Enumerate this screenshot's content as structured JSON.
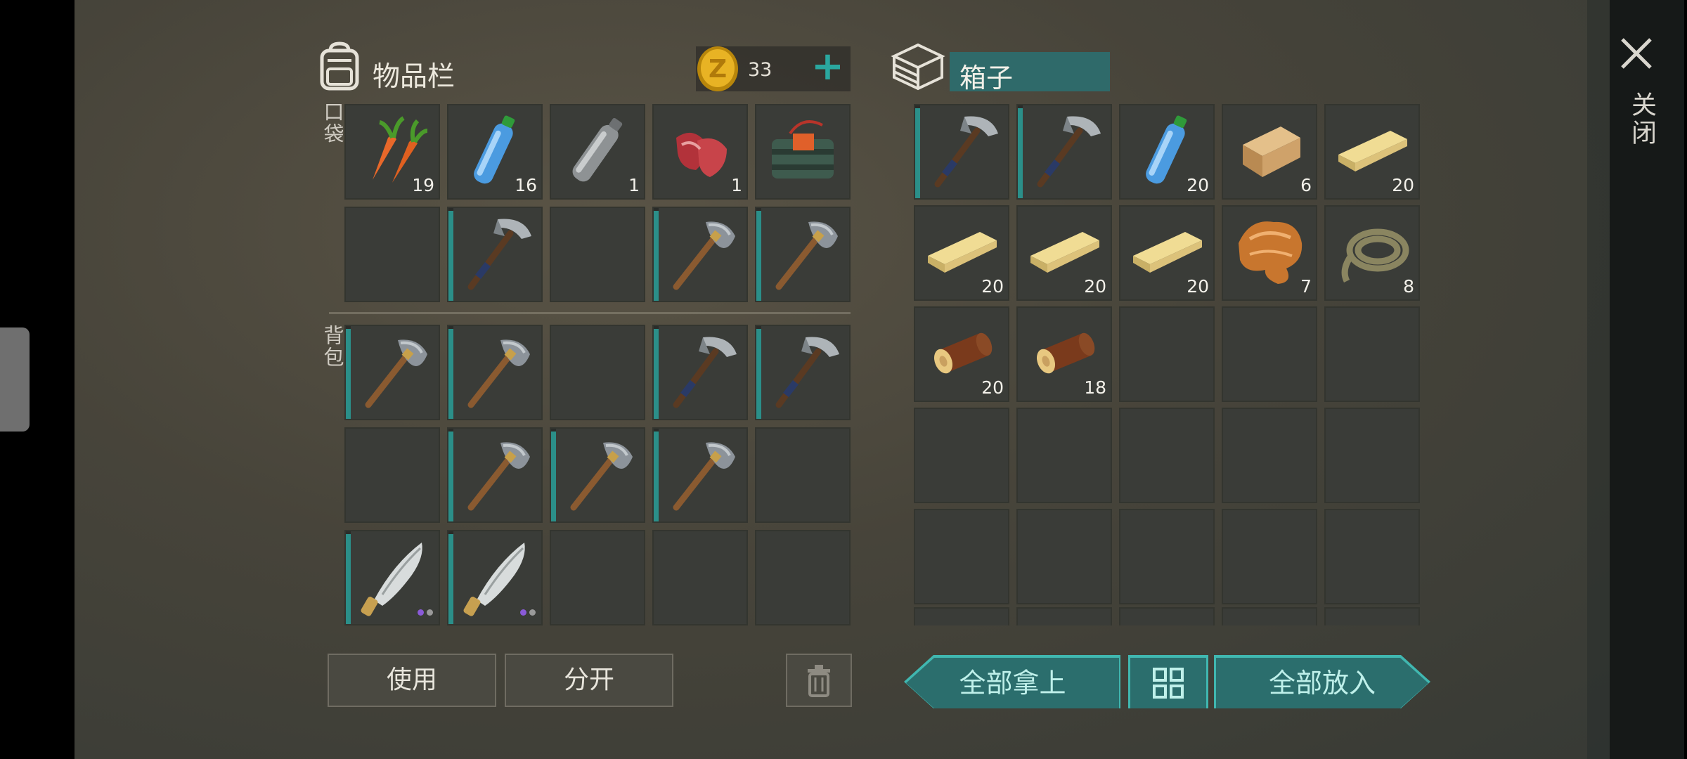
{
  "inventory": {
    "title": "物品栏",
    "coins": "33",
    "add_symbol": "+",
    "pocket_label": "口袋",
    "backpack_label": "背包",
    "pocket_slots": [
      {
        "item": "carrot",
        "count": "19"
      },
      {
        "item": "water-bottle",
        "count": "16"
      },
      {
        "item": "empty-bottle",
        "count": "1"
      },
      {
        "item": "raw-meat",
        "count": "1"
      },
      {
        "item": "explosive-pack",
        "count": ""
      },
      {
        "item": "",
        "count": ""
      },
      {
        "item": "iron-axe",
        "count": ""
      },
      {
        "item": "",
        "count": ""
      },
      {
        "item": "stone-axe",
        "count": ""
      },
      {
        "item": "stone-axe",
        "count": ""
      }
    ],
    "backpack_slots": [
      {
        "item": "stone-axe",
        "count": ""
      },
      {
        "item": "stone-axe",
        "count": ""
      },
      {
        "item": "",
        "count": ""
      },
      {
        "item": "iron-axe",
        "count": ""
      },
      {
        "item": "iron-axe",
        "count": ""
      },
      {
        "item": "",
        "count": ""
      },
      {
        "item": "stone-axe",
        "count": ""
      },
      {
        "item": "stone-axe",
        "count": ""
      },
      {
        "item": "stone-axe",
        "count": ""
      },
      {
        "item": "",
        "count": ""
      },
      {
        "item": "machete",
        "count": ""
      },
      {
        "item": "machete",
        "count": ""
      },
      {
        "item": "",
        "count": ""
      },
      {
        "item": "",
        "count": ""
      },
      {
        "item": "",
        "count": ""
      }
    ]
  },
  "box": {
    "title": "箱子",
    "slots": [
      {
        "item": "iron-axe",
        "count": ""
      },
      {
        "item": "iron-axe",
        "count": ""
      },
      {
        "item": "water-bottle",
        "count": "20"
      },
      {
        "item": "wood-block",
        "count": "6"
      },
      {
        "item": "plank",
        "count": "20"
      },
      {
        "item": "plank",
        "count": "20"
      },
      {
        "item": "plank",
        "count": "20"
      },
      {
        "item": "plank",
        "count": "20"
      },
      {
        "item": "fur",
        "count": "7"
      },
      {
        "item": "rope",
        "count": "8"
      },
      {
        "item": "log",
        "count": "20"
      },
      {
        "item": "log",
        "count": "18"
      },
      {
        "item": "",
        "count": ""
      },
      {
        "item": "",
        "count": ""
      },
      {
        "item": "",
        "count": ""
      },
      {
        "item": "",
        "count": ""
      },
      {
        "item": "",
        "count": ""
      },
      {
        "item": "",
        "count": ""
      },
      {
        "item": "",
        "count": ""
      },
      {
        "item": "",
        "count": ""
      },
      {
        "item": "",
        "count": ""
      },
      {
        "item": "",
        "count": ""
      },
      {
        "item": "",
        "count": ""
      },
      {
        "item": "",
        "count": ""
      },
      {
        "item": "",
        "count": ""
      }
    ]
  },
  "buttons": {
    "use": "使用",
    "split": "分开",
    "take_all": "全部拿上",
    "put_all": "全部放入",
    "close": "关闭"
  },
  "colors": {
    "accent": "#2b6e6d",
    "durability": "#2b8f89",
    "slot": "#3a3c38"
  }
}
